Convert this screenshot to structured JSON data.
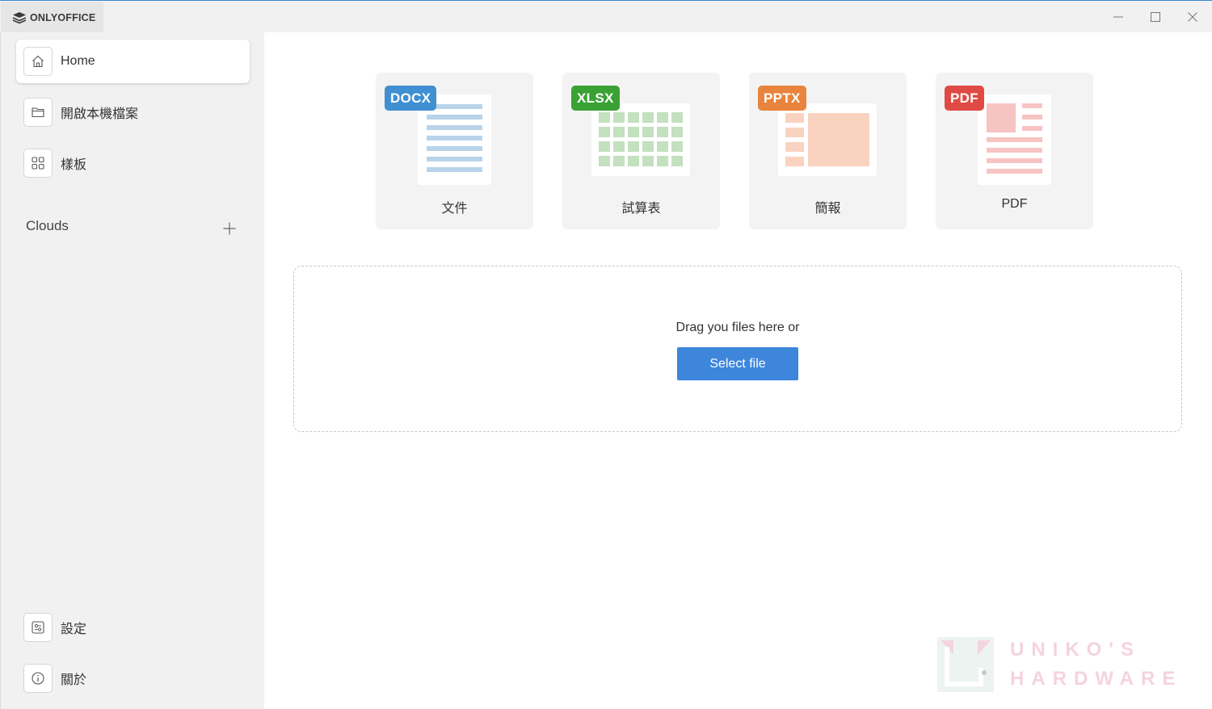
{
  "app": {
    "name": "ONLYOFFICE"
  },
  "window_controls": {
    "minimize_icon": "minimize-icon",
    "maximize_icon": "maximize-icon",
    "close_icon": "close-icon"
  },
  "sidebar": {
    "items": [
      {
        "label": "Home",
        "icon": "home-icon",
        "active": true
      },
      {
        "label": "開啟本機檔案",
        "icon": "folder-icon",
        "active": false
      },
      {
        "label": "樣板",
        "icon": "grid-icon",
        "active": false
      }
    ],
    "clouds_label": "Clouds",
    "bottom_items": [
      {
        "label": "設定",
        "icon": "settings-icon"
      },
      {
        "label": "關於",
        "icon": "info-icon"
      }
    ]
  },
  "create_cards": [
    {
      "badge": "DOCX",
      "label": "文件",
      "color": "#3f8fd2"
    },
    {
      "badge": "XLSX",
      "label": "試算表",
      "color": "#3aa135"
    },
    {
      "badge": "PPTX",
      "label": "簡報",
      "color": "#e8843d"
    },
    {
      "badge": "PDF",
      "label": "PDF",
      "color": "#e04a44"
    }
  ],
  "dropzone": {
    "text": "Drag you files here or",
    "button": "Select file"
  },
  "watermark": {
    "line1": "UNIKO'S",
    "line2": "HARDWARE"
  },
  "colors": {
    "accent": "#3d86dc",
    "sidebar_bg": "#f1f1f1"
  }
}
